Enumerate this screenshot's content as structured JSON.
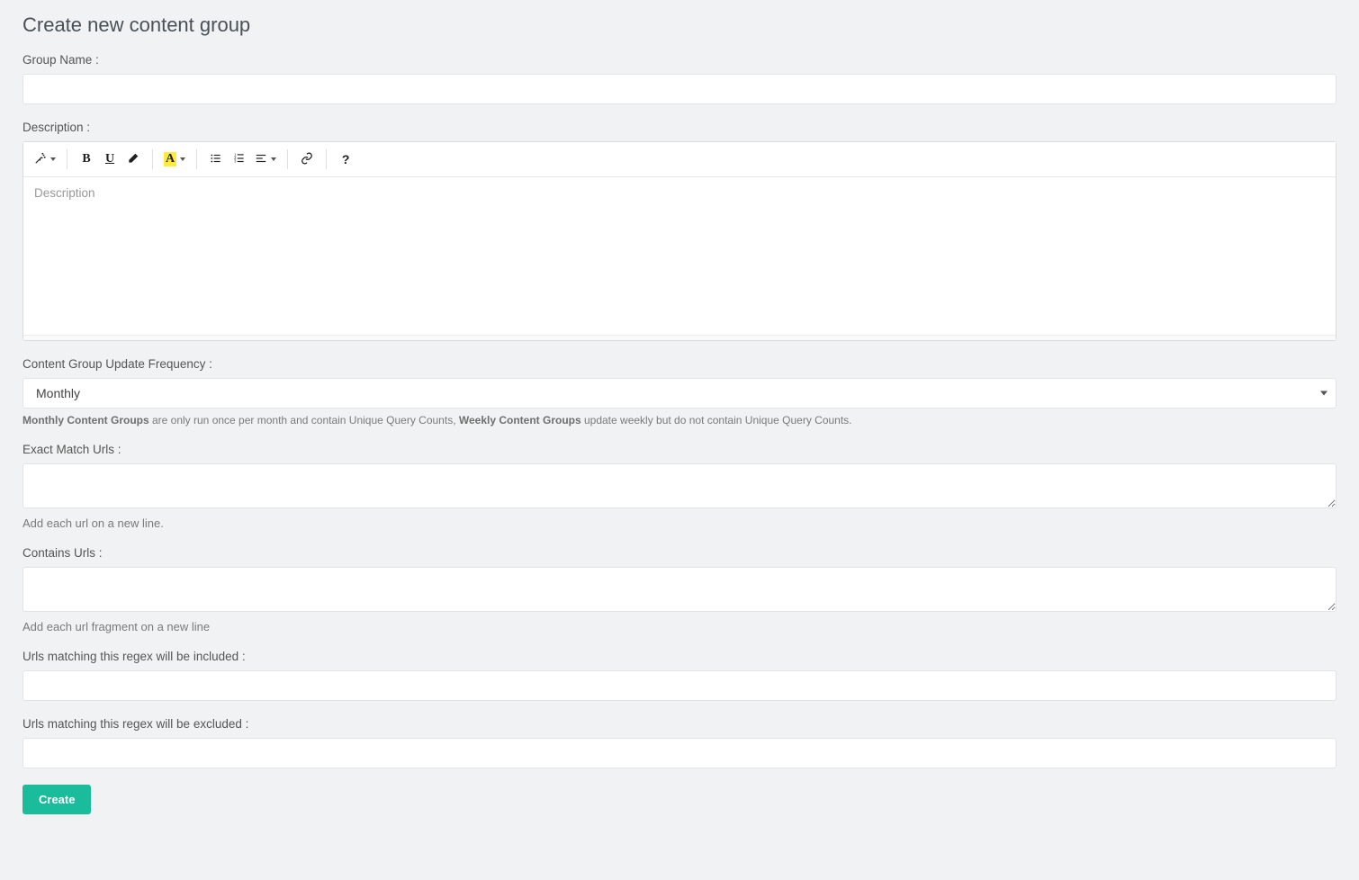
{
  "page_title": "Create new content group",
  "form": {
    "group_name": {
      "label": "Group Name :",
      "value": ""
    },
    "description": {
      "label": "Description :",
      "placeholder": "Description",
      "value": ""
    },
    "frequency": {
      "label": "Content Group Update Frequency :",
      "selected": "Monthly",
      "help_prefix_bold1": "Monthly Content Groups",
      "help_mid1": " are only run once per month and contain Unique Query Counts, ",
      "help_prefix_bold2": "Weekly Content Groups",
      "help_mid2": " update weekly but do not contain Unique Query Counts."
    },
    "exact_match": {
      "label": "Exact Match Urls :",
      "value": "",
      "help": "Add each url on a new line."
    },
    "contains_urls": {
      "label": "Contains Urls :",
      "value": "",
      "help": "Add each url fragment on a new line"
    },
    "regex_include": {
      "label": "Urls matching this regex will be included :",
      "value": ""
    },
    "regex_exclude": {
      "label": "Urls matching this regex will be excluded :",
      "value": ""
    }
  },
  "buttons": {
    "create": "Create"
  },
  "toolbar": {
    "magic": "magic",
    "bold": "B",
    "underline": "U",
    "erase": "erase",
    "font_color": "A",
    "ul": "ul",
    "ol": "ol",
    "paragraph": "paragraph",
    "link": "link",
    "help": "?"
  }
}
